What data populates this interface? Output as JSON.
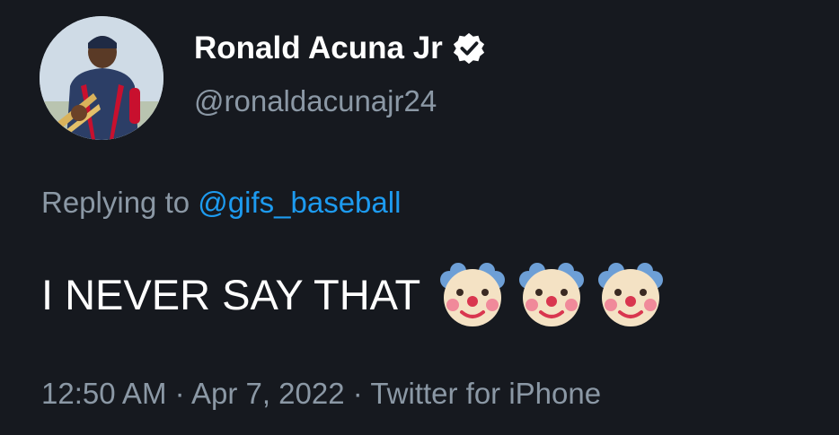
{
  "tweet": {
    "author": {
      "display_name": "Ronald Acuna Jr",
      "handle": "@ronaldacunajr24",
      "verified": true,
      "avatar_icon": "baseball-player-avatar"
    },
    "reply": {
      "prefix": "Replying to",
      "mention": "@gifs_baseball"
    },
    "text": "I NEVER SAY THAT",
    "emojis": [
      "clown-face",
      "clown-face",
      "clown-face"
    ],
    "timestamp": {
      "time": "12:50 AM",
      "separator1": " · ",
      "date": "Apr 7, 2022",
      "separator2": " · ",
      "source": "Twitter for iPhone"
    },
    "colors": {
      "background": "#16191f",
      "secondary_text": "#8b98a5",
      "link": "#1d9bf0",
      "primary_text": "#ffffff"
    }
  }
}
